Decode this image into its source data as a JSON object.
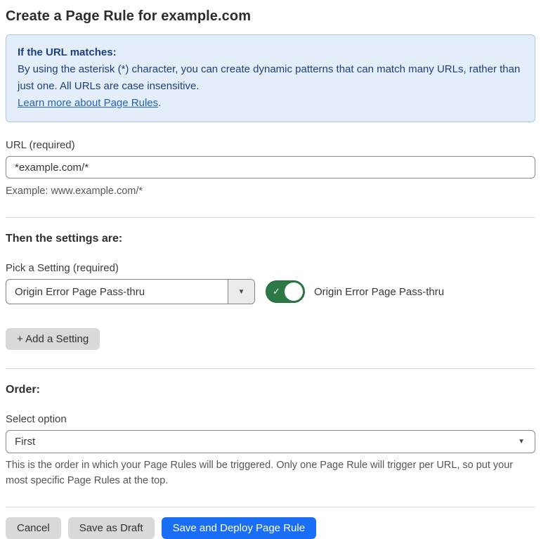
{
  "page": {
    "title": "Create a Page Rule for example.com"
  },
  "info_box": {
    "heading": "If the URL matches:",
    "body": "By using the asterisk (*) character, you can create dynamic patterns that can match many URLs, rather than just one. All URLs are case insensitive.",
    "link_label": "Learn more about Page Rules",
    "link_suffix": "."
  },
  "url_field": {
    "label": "URL (required)",
    "value": "*example.com/*",
    "example": "Example: www.example.com/*"
  },
  "settings": {
    "heading": "Then the settings are:",
    "picker_label": "Pick a Setting (required)",
    "selected_setting": "Origin Error Page Pass-thru",
    "toggle_state": "on",
    "toggle_label": "Origin Error Page Pass-thru",
    "add_button_label": "+ Add a Setting"
  },
  "order": {
    "heading": "Order:",
    "label": "Select option",
    "selected_option": "First",
    "help_text": "This is the order in which your Page Rules will be triggered. Only one Page Rule will trigger per URL, so put your most specific Page Rules at the top."
  },
  "actions": {
    "cancel_label": "Cancel",
    "save_draft_label": "Save as Draft",
    "save_deploy_label": "Save and Deploy Page Rule"
  },
  "icons": {
    "dropdown_arrow": "▼",
    "check": "✓"
  },
  "colors": {
    "info_bg": "#e4eefb",
    "info_border": "#a9c9ec",
    "info_text": "#1b3f7e",
    "link": "#2262c1",
    "toggle_on": "#2b7a45",
    "primary_button": "#1a6ef5",
    "secondary_button": "#d9d9d9"
  }
}
